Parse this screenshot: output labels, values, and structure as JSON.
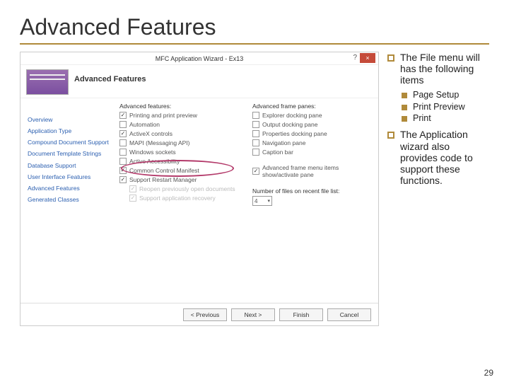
{
  "slide": {
    "title": "Advanced Features",
    "page_number": "29"
  },
  "wizard": {
    "titlebar": "MFC Application Wizard - Ex13",
    "heading": "Advanced Features",
    "nav": {
      "overview": "Overview",
      "app_type": "Application Type",
      "cds": "Compound Document Support",
      "dts": "Document Template Strings",
      "dbs": "Database Support",
      "uif": "User Interface Features",
      "af": "Advanced Features",
      "gc": "Generated Classes"
    },
    "labels": {
      "adv_features": "Advanced features:",
      "adv_frame": "Advanced frame panes:",
      "num_files": "Number of files on recent file list:",
      "afm": "Advanced frame menu items show/activate pane"
    },
    "left_items": {
      "print_preview": "Printing and print preview",
      "automation": "Automation",
      "activex": "ActiveX controls",
      "mapi": "MAPI (Messaging API)",
      "sockets": "Windows sockets",
      "aa": "Active Accessibility",
      "ccm": "Common Control Manifest",
      "restart": "Support Restart Manager",
      "reopen": "Reopen previously open documents",
      "recovery": "Support application recovery"
    },
    "right_items": {
      "explorer": "Explorer docking pane",
      "output": "Output docking pane",
      "props": "Properties docking pane",
      "navpane": "Navigation pane",
      "caption": "Caption bar"
    },
    "recent_value": "4",
    "buttons": {
      "prev": "< Previous",
      "next": "Next >",
      "finish": "Finish",
      "cancel": "Cancel"
    }
  },
  "notes": {
    "p1": "The File menu will has the following items",
    "s1": "Page Setup",
    "s2": "Print Preview",
    "s3": "Print",
    "p2": "The Application wizard also provides code to support these functions."
  }
}
